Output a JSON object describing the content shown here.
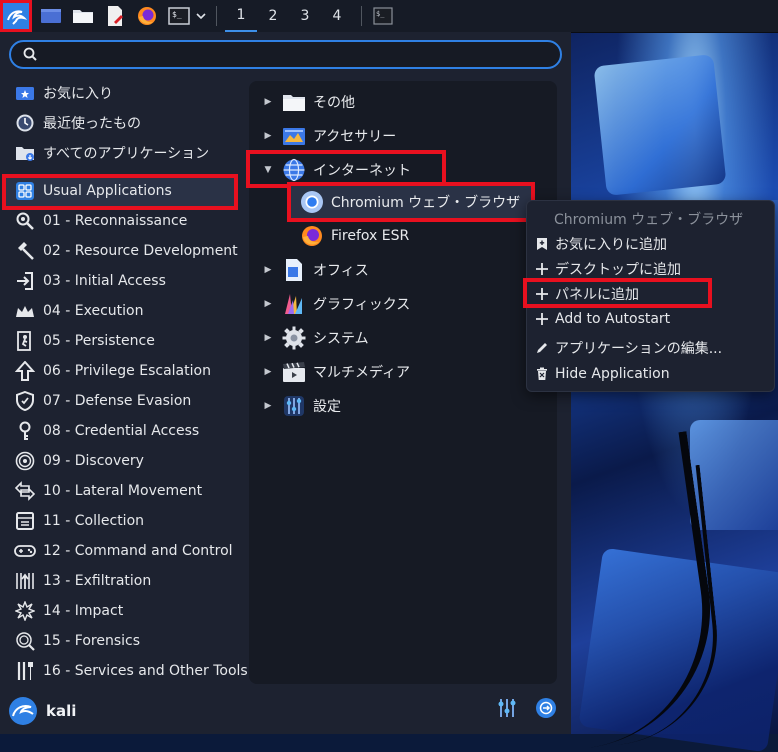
{
  "taskbar": {
    "workspaces": [
      "1",
      "2",
      "3",
      "4"
    ],
    "active_workspace": "1"
  },
  "search": {
    "placeholder": ""
  },
  "sidebar": {
    "favorites": "お気に入り",
    "recent": "最近使ったもの",
    "all_apps": "すべてのアプリケーション",
    "usual_apps": "Usual Applications",
    "categories": [
      {
        "label": "01 - Reconnaissance",
        "icon": "magnifier-icon"
      },
      {
        "label": "02 - Resource Development",
        "icon": "hammer-icon"
      },
      {
        "label": "03 - Initial Access",
        "icon": "login-icon"
      },
      {
        "label": "04 - Execution",
        "icon": "crown-icon"
      },
      {
        "label": "05 - Persistence",
        "icon": "person-door-icon"
      },
      {
        "label": "06 - Privilege Escalation",
        "icon": "arrow-up-icon"
      },
      {
        "label": "07 - Defense Evasion",
        "icon": "shield-icon"
      },
      {
        "label": "08 - Credential Access",
        "icon": "key-icon"
      },
      {
        "label": "09 - Discovery",
        "icon": "radar-icon"
      },
      {
        "label": "10 - Lateral Movement",
        "icon": "arrows-lr-icon"
      },
      {
        "label": "11 - Collection",
        "icon": "box-icon"
      },
      {
        "label": "12 - Command and Control",
        "icon": "gamepad-icon"
      },
      {
        "label": "13 - Exfiltration",
        "icon": "upload-grid-icon"
      },
      {
        "label": "14 - Impact",
        "icon": "explosion-icon"
      },
      {
        "label": "15 - Forensics",
        "icon": "fingerprint-icon"
      },
      {
        "label": "16 - Services and Other Tools",
        "icon": "tools-icon"
      }
    ]
  },
  "main": {
    "categories": [
      {
        "label": "その他",
        "expanded": false
      },
      {
        "label": "アクセサリー",
        "expanded": false
      },
      {
        "label": "インターネット",
        "expanded": true
      },
      {
        "label": "オフィス",
        "expanded": false
      },
      {
        "label": "グラフィックス",
        "expanded": false
      },
      {
        "label": "システム",
        "expanded": false
      },
      {
        "label": "マルチメディア",
        "expanded": false
      },
      {
        "label": "設定",
        "expanded": false
      }
    ],
    "internet_apps": [
      "Chromium ウェブ・ブラウザ",
      "Firefox ESR"
    ]
  },
  "footer": {
    "username": "kali"
  },
  "context_menu": {
    "title": "Chromium ウェブ・ブラウザ",
    "items": [
      {
        "label": "お気に入りに追加",
        "icon": "bookmark-add-icon"
      },
      {
        "label": "デスクトップに追加",
        "icon": "plus-icon"
      },
      {
        "label": "パネルに追加",
        "icon": "plus-icon"
      },
      {
        "label": "Add to Autostart",
        "icon": "plus-icon"
      },
      {
        "label": "アプリケーションの編集...",
        "icon": "pencil-icon"
      },
      {
        "label": "Hide Application",
        "icon": "trash-icon"
      }
    ]
  },
  "colors": {
    "accent": "#2f80e4",
    "highlight_box": "#e8101f",
    "menu_bg": "#1d2230",
    "pane_bg": "#161a24"
  }
}
